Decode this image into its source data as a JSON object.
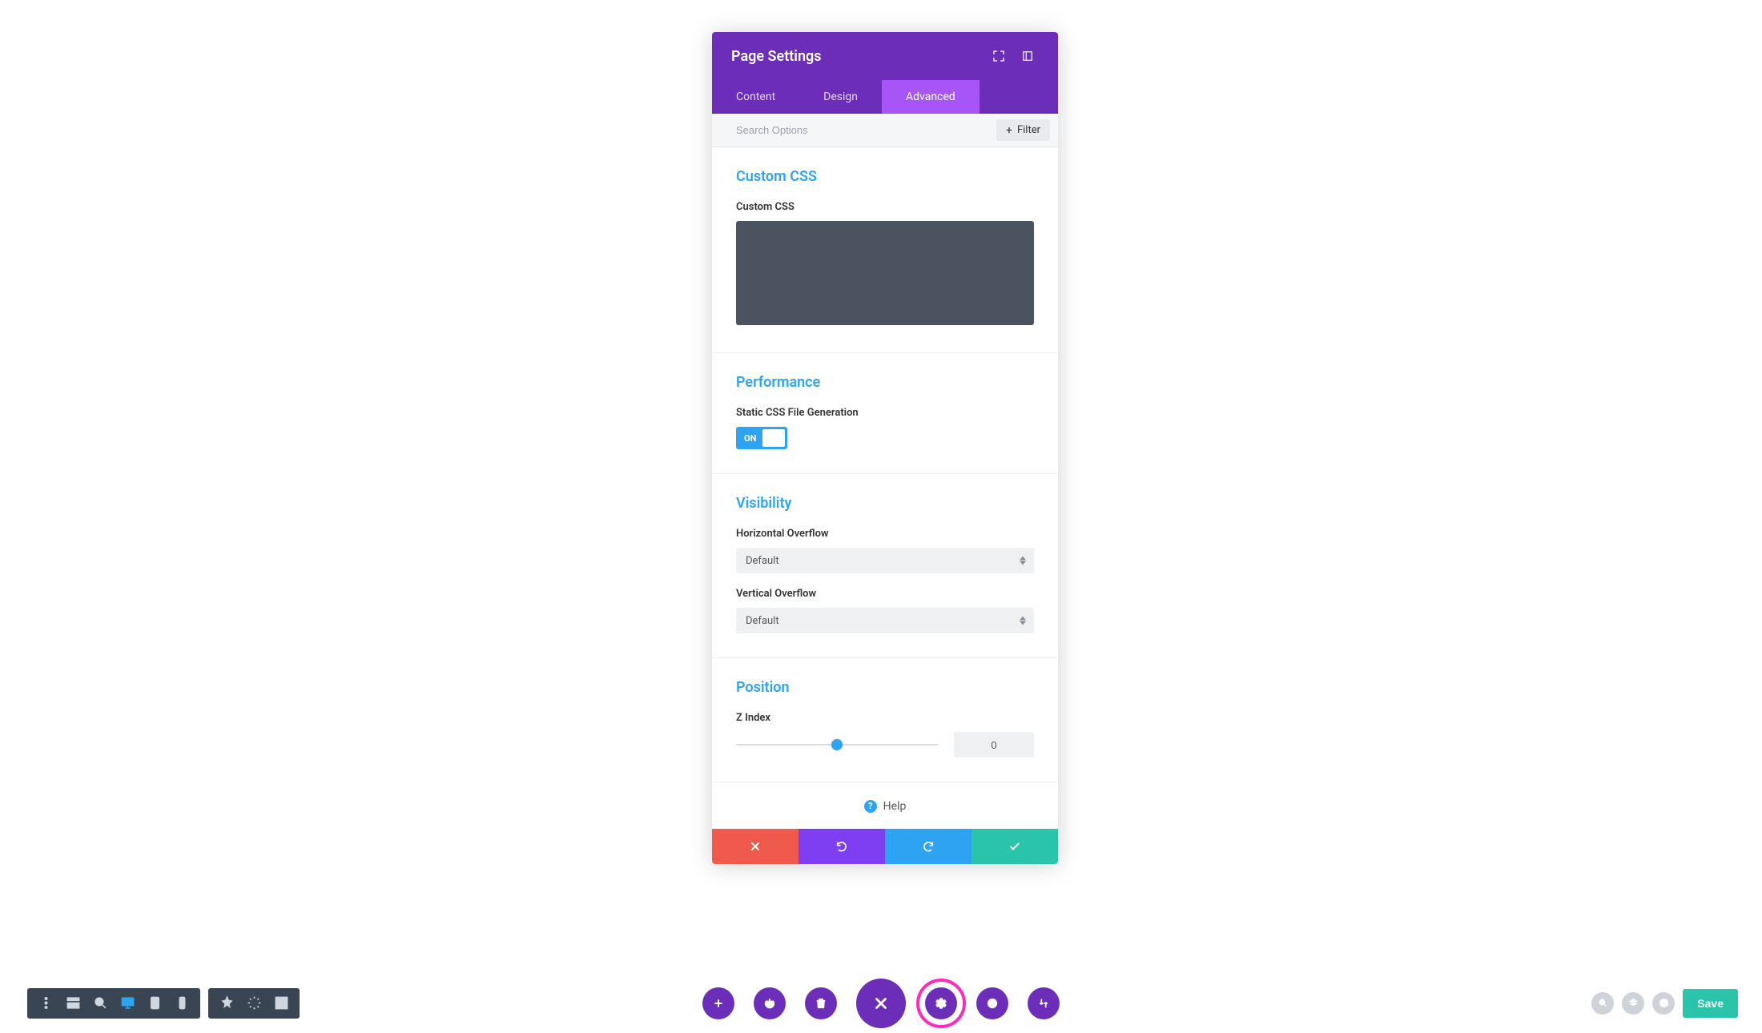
{
  "panel": {
    "title": "Page Settings",
    "tabs": [
      "Content",
      "Design",
      "Advanced"
    ],
    "activeTab": 2,
    "search_placeholder": "Search Options",
    "filter_label": "Filter",
    "sections": {
      "customCSS": {
        "title": "Custom CSS",
        "field_label": "Custom CSS",
        "value": ""
      },
      "performance": {
        "title": "Performance",
        "field_label": "Static CSS File Generation",
        "toggle_state": "ON"
      },
      "visibility": {
        "title": "Visibility",
        "horizontal_label": "Horizontal Overflow",
        "horizontal_value": "Default",
        "vertical_label": "Vertical Overflow",
        "vertical_value": "Default"
      },
      "position": {
        "title": "Position",
        "zindex_label": "Z Index",
        "zindex_value": "0"
      }
    },
    "help_label": "Help"
  },
  "bottombar": {
    "save_label": "Save"
  }
}
